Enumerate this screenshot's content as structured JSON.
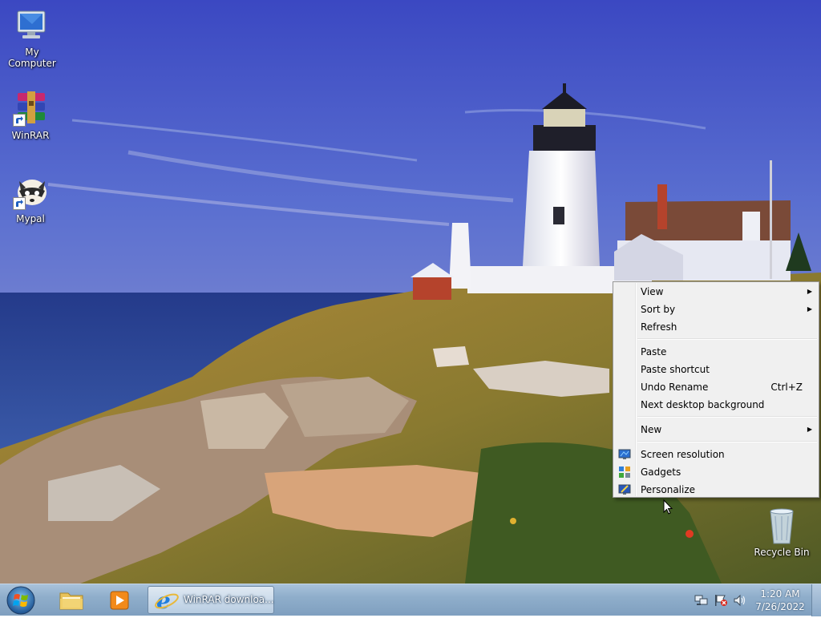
{
  "desktop": {
    "icons": [
      {
        "label": "My Computer",
        "icon": "computer-icon"
      },
      {
        "label": "WinRAR",
        "icon": "winrar-icon"
      },
      {
        "label": "Mypal",
        "icon": "mypal-icon"
      },
      {
        "label": "Recycle Bin",
        "icon": "recycle-bin-icon"
      }
    ]
  },
  "context_menu": {
    "items": [
      {
        "label": "View",
        "submenu": true
      },
      {
        "label": "Sort by",
        "submenu": true
      },
      {
        "label": "Refresh"
      },
      {
        "label": "Paste"
      },
      {
        "label": "Paste shortcut"
      },
      {
        "label": "Undo Rename",
        "shortcut": "Ctrl+Z"
      },
      {
        "label": "Next desktop background"
      },
      {
        "label": "New",
        "submenu": true
      },
      {
        "label": "Screen resolution",
        "icon": "screen-resolution-icon"
      },
      {
        "label": "Gadgets",
        "icon": "gadgets-icon"
      },
      {
        "label": "Personalize",
        "icon": "personalize-icon"
      }
    ]
  },
  "taskbar": {
    "start_icon": "windows-orb-icon",
    "pinned": [
      {
        "icon": "explorer-folder-icon"
      },
      {
        "icon": "media-player-icon"
      }
    ],
    "task": {
      "label": "WinRAR downloa...",
      "icon": "internet-explorer-icon"
    },
    "tray": [
      "network-icon",
      "action-center-flag-icon",
      "volume-icon"
    ],
    "clock": {
      "time": "1:20 AM",
      "date": "7/26/2022"
    }
  },
  "colors": {
    "menu_bg": "#f0f0f0",
    "taskbar": "#8faecb",
    "sky": "#4a5fc4"
  }
}
